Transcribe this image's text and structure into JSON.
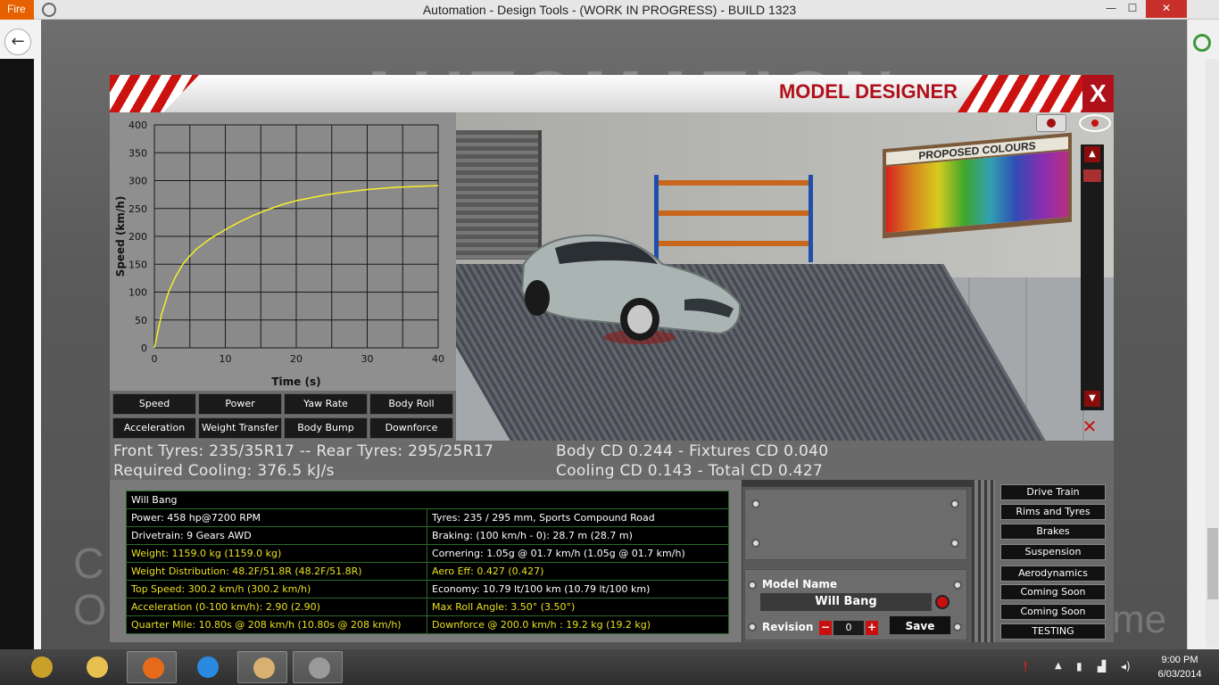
{
  "window": {
    "title": "Automation - Design Tools - (WORK IN PROGRESS) - BUILD 1323",
    "tab_label": "Fire",
    "minimize_glyph": "—",
    "maximize_glyph": "☐",
    "close_glyph": "✕"
  },
  "browser": {
    "back_glyph": "←"
  },
  "backdrop": {
    "logo_text": "AUTOMATION",
    "left_text_1": "C",
    "left_text_2": "O",
    "right_text": "me"
  },
  "panel": {
    "title": "MODEL DESIGNER",
    "close_label": "X"
  },
  "graph": {
    "buttons": [
      {
        "label": "Speed"
      },
      {
        "label": "Power"
      },
      {
        "label": "Yaw Rate"
      },
      {
        "label": "Body Roll"
      },
      {
        "label": "Acceleration"
      },
      {
        "label": "Weight Transfer"
      },
      {
        "label": "Body Bump"
      },
      {
        "label": "Downforce"
      }
    ]
  },
  "chart_data": {
    "type": "line",
    "title": "",
    "xlabel": "Time (s)",
    "ylabel": "Speed (km/h)",
    "xlim": [
      0,
      40
    ],
    "ylim": [
      0,
      400
    ],
    "x_ticks": [
      "0",
      "10",
      "20",
      "30",
      "40"
    ],
    "y_ticks": [
      "0",
      "50",
      "100",
      "150",
      "200",
      "250",
      "300",
      "350",
      "400"
    ],
    "grid": true,
    "series": [
      {
        "color": "#f4ef2a",
        "x": [
          0,
          1,
          2,
          3,
          4,
          5,
          6,
          8,
          10,
          12,
          14,
          16,
          18,
          20,
          22,
          24,
          26,
          28,
          30,
          32,
          34,
          36,
          38,
          40
        ],
        "y": [
          0,
          60,
          100,
          128,
          150,
          165,
          178,
          197,
          212,
          226,
          238,
          248,
          257,
          264,
          269,
          274,
          278,
          281,
          284,
          286,
          288,
          289,
          290,
          291
        ]
      }
    ]
  },
  "viewport": {
    "palette_title": "PROPOSED COLOURS",
    "camera_icon": "camera-icon",
    "eye_icon": "eye-icon",
    "zoom_up_glyph": "▲",
    "zoom_down_glyph": "▼",
    "reset_glyph": "✕"
  },
  "info": {
    "tyres": "Front Tyres: 235/35R17 -- Rear Tyres: 295/25R17",
    "cooling": "Required Cooling: 376.5 kJ/s",
    "body_cd": "Body CD 0.244 - Fixtures CD 0.040",
    "total_cd": "Cooling CD 0.143 - Total CD 0.427"
  },
  "stats": {
    "name": "Will Bang",
    "rows": [
      {
        "left": "Power: 458 hp@7200 RPM",
        "right": "Tyres: 235 / 295 mm, Sports Compound Road",
        "left_color": "w",
        "right_color": "w"
      },
      {
        "left": "Drivetrain: 9 Gears AWD",
        "right": "Braking: (100 km/h - 0): 28.7 m (28.7 m)",
        "left_color": "w",
        "right_color": "w"
      },
      {
        "left": "Weight: 1159.0 kg (1159.0 kg)",
        "right": "Cornering: 1.05g @ 01.7 km/h (1.05g @ 01.7 km/h)",
        "left_color": "y",
        "right_color": "w"
      },
      {
        "left": "Weight Distribution: 48.2F/51.8R (48.2F/51.8R)",
        "right": "Aero Eff: 0.427 (0.427)",
        "left_color": "y",
        "right_color": "y"
      },
      {
        "left": "Top Speed: 300.2 km/h (300.2 km/h)",
        "right": "Economy: 10.79 lt/100 km (10.79 lt/100 km)",
        "left_color": "y",
        "right_color": "w"
      },
      {
        "left": "Acceleration (0-100 km/h): 2.90 (2.90)",
        "right": "Max Roll Angle: 3.50° (3.50°)",
        "left_color": "y",
        "right_color": "y"
      },
      {
        "left": "Quarter Mile: 10.80s @ 208 km/h (10.80s @ 208 km/h)",
        "right": "Downforce @ 200.0 km/h : 19.2 kg (19.2 kg)",
        "left_color": "y",
        "right_color": "y"
      }
    ]
  },
  "model": {
    "name_label": "Model Name",
    "name_value": "Will Bang",
    "revision_label": "Revision",
    "revision_value": "0",
    "minus_glyph": "−",
    "plus_glyph": "+",
    "save_label": "Save"
  },
  "categories": [
    {
      "label": "Drive Train"
    },
    {
      "label": "Rims and Tyres"
    },
    {
      "label": "Brakes"
    },
    {
      "label": "Suspension"
    },
    {
      "label": "Aerodynamics"
    },
    {
      "label": "Coming Soon"
    },
    {
      "label": "Coming Soon"
    },
    {
      "label": "TESTING"
    }
  ],
  "taskbar": {
    "apps": [
      {
        "icon": "wow-icon",
        "color": "#c8a02a"
      },
      {
        "icon": "file-explorer-icon",
        "color": "#e8c050"
      },
      {
        "icon": "firefox-icon",
        "color": "#e66a1a"
      },
      {
        "icon": "internet-explorer-icon",
        "color": "#2a8ae0"
      },
      {
        "icon": "paint-icon",
        "color": "#d8b070"
      },
      {
        "icon": "automation-icon",
        "color": "#9a9a9a"
      }
    ],
    "tray_arrow": "▲",
    "time": "9:00 PM",
    "date": "6/03/2014"
  }
}
